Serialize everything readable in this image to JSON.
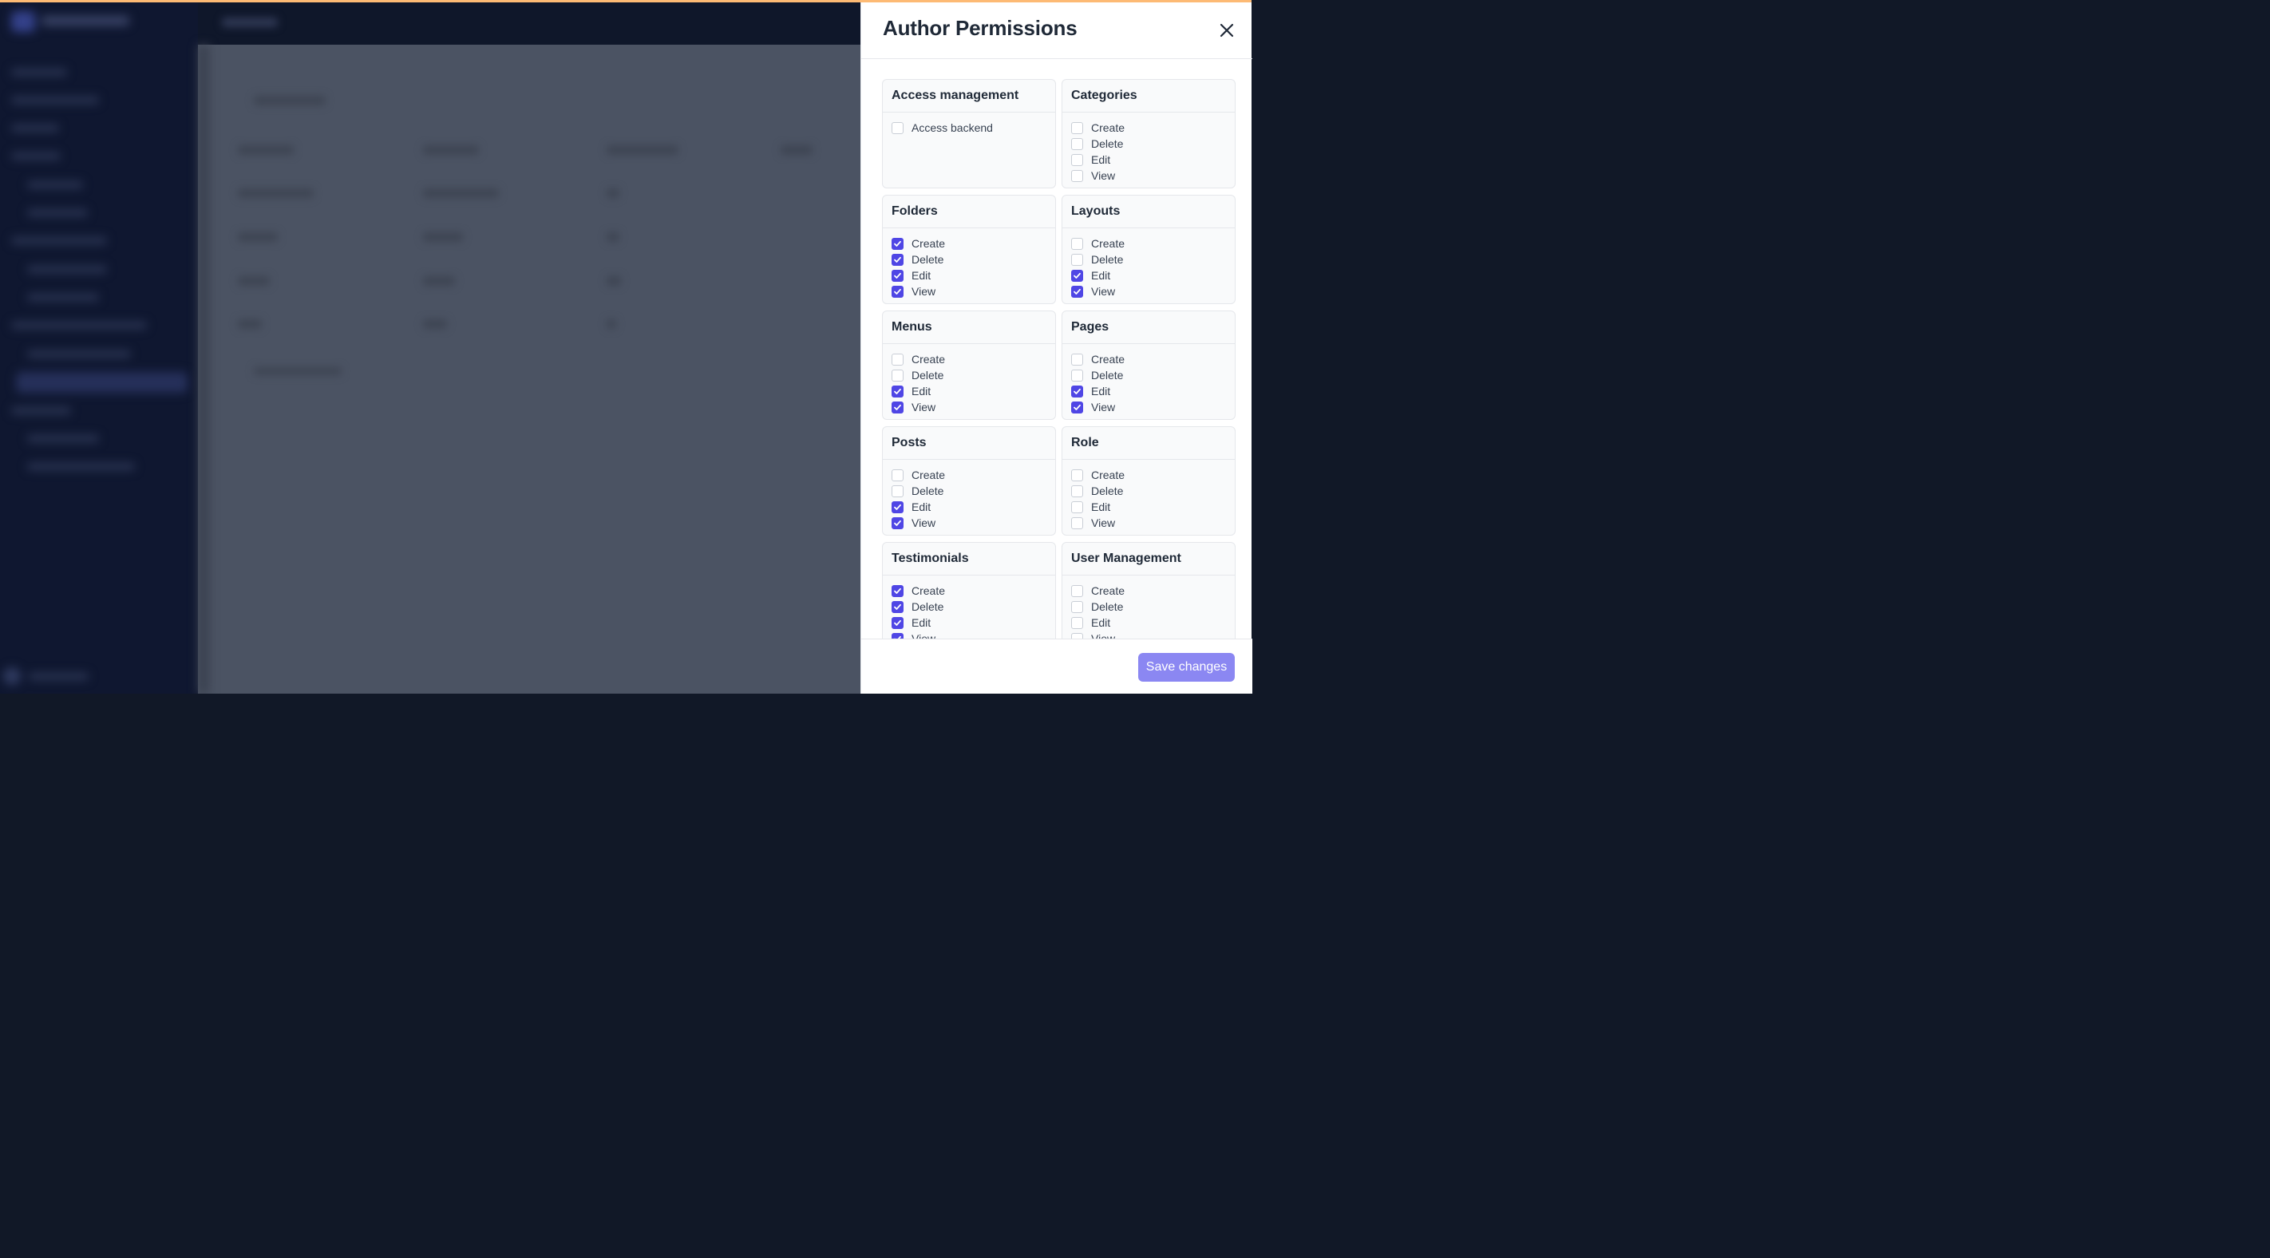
{
  "drawer": {
    "title": "Author Permissions",
    "close_icon": "close-icon",
    "save_label": "Save changes"
  },
  "colors": {
    "accent": "#4f46e5",
    "save_button": "#8b87f2",
    "top_accent": "#fdba74"
  },
  "groups": [
    {
      "title": "Access management",
      "perms": [
        {
          "label": "Access backend",
          "checked": false
        }
      ]
    },
    {
      "title": "Categories",
      "perms": [
        {
          "label": "Create",
          "checked": false
        },
        {
          "label": "Delete",
          "checked": false
        },
        {
          "label": "Edit",
          "checked": false
        },
        {
          "label": "View",
          "checked": false
        }
      ]
    },
    {
      "title": "Folders",
      "perms": [
        {
          "label": "Create",
          "checked": true
        },
        {
          "label": "Delete",
          "checked": true
        },
        {
          "label": "Edit",
          "checked": true
        },
        {
          "label": "View",
          "checked": true
        }
      ]
    },
    {
      "title": "Layouts",
      "perms": [
        {
          "label": "Create",
          "checked": false
        },
        {
          "label": "Delete",
          "checked": false
        },
        {
          "label": "Edit",
          "checked": true
        },
        {
          "label": "View",
          "checked": true
        }
      ]
    },
    {
      "title": "Menus",
      "perms": [
        {
          "label": "Create",
          "checked": false
        },
        {
          "label": "Delete",
          "checked": false
        },
        {
          "label": "Edit",
          "checked": true
        },
        {
          "label": "View",
          "checked": true
        }
      ]
    },
    {
      "title": "Pages",
      "perms": [
        {
          "label": "Create",
          "checked": false
        },
        {
          "label": "Delete",
          "checked": false
        },
        {
          "label": "Edit",
          "checked": true
        },
        {
          "label": "View",
          "checked": true
        }
      ]
    },
    {
      "title": "Posts",
      "perms": [
        {
          "label": "Create",
          "checked": false
        },
        {
          "label": "Delete",
          "checked": false
        },
        {
          "label": "Edit",
          "checked": true
        },
        {
          "label": "View",
          "checked": true
        }
      ]
    },
    {
      "title": "Role",
      "perms": [
        {
          "label": "Create",
          "checked": false
        },
        {
          "label": "Delete",
          "checked": false
        },
        {
          "label": "Edit",
          "checked": false
        },
        {
          "label": "View",
          "checked": false
        }
      ]
    },
    {
      "title": "Testimonials",
      "perms": [
        {
          "label": "Create",
          "checked": true
        },
        {
          "label": "Delete",
          "checked": true
        },
        {
          "label": "Edit",
          "checked": true
        },
        {
          "label": "View",
          "checked": true
        }
      ]
    },
    {
      "title": "User Management",
      "perms": [
        {
          "label": "Create",
          "checked": false
        },
        {
          "label": "Delete",
          "checked": false
        },
        {
          "label": "Edit",
          "checked": false
        },
        {
          "label": "View",
          "checked": false
        }
      ]
    }
  ]
}
